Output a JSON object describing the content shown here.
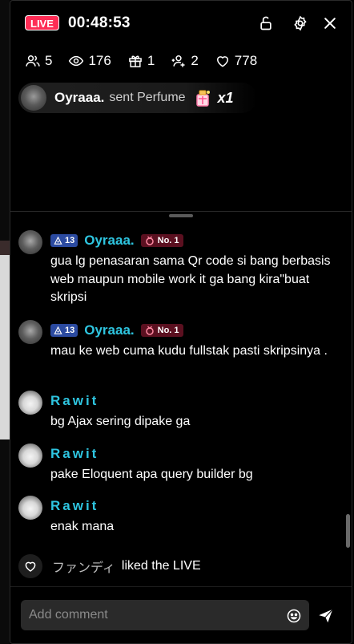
{
  "header": {
    "live_badge": "LIVE",
    "timer": "00:48:53",
    "icons": [
      "lock-open-icon",
      "settings-icon",
      "close-icon"
    ]
  },
  "stats": [
    {
      "icon": "users-icon",
      "value": "5"
    },
    {
      "icon": "eye-icon",
      "value": "176"
    },
    {
      "icon": "gift-icon",
      "value": "1"
    },
    {
      "icon": "add-user-icon",
      "value": "2"
    },
    {
      "icon": "heart-icon",
      "value": "778"
    }
  ],
  "gift_banner": {
    "user": "Oyraaa.",
    "text": "sent Perfume",
    "count": "x1"
  },
  "messages": [
    {
      "user": "Oyraaa.",
      "level": "13",
      "rank": "No. 1",
      "text": "gua lg penasaran sama Qr code si bang berbasis web maupun mobile work it ga bang kira\"buat skripsi"
    },
    {
      "user": "Oyraaa.",
      "level": "13",
      "rank": "No. 1",
      "text": "mau ke web cuma kudu fullstak pasti skripsinya ."
    },
    {
      "user": "Rawit",
      "text": "bg Ajax sering dipake ga"
    },
    {
      "user": "Rawit",
      "text": "pake Eloquent apa query builder bg"
    },
    {
      "user": "Rawit",
      "text": "enak mana"
    }
  ],
  "like_event": {
    "user": "ファンディ",
    "text": "liked the LIVE"
  },
  "comment": {
    "placeholder": "Add comment"
  },
  "colors": {
    "live_red": "#fe2c55",
    "username_cyan": "#2ec5e0",
    "level_blue": "#2b4aa0",
    "rank_red": "#5b1020"
  }
}
